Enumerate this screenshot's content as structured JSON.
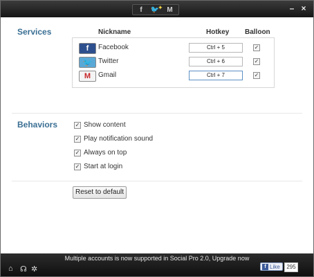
{
  "titlebar": {
    "icons": [
      "facebook-icon",
      "twitter-icon",
      "gmail-icon"
    ],
    "minimize_label": "–",
    "close_label": "×"
  },
  "services": {
    "title": "Services",
    "headers": {
      "nickname": "Nickname",
      "hotkey": "Hotkey",
      "balloon": "Balloon"
    },
    "items": [
      {
        "name": "Facebook",
        "icon": "facebook-icon",
        "icon_glyph": "f",
        "hotkey": "Ctrl + 5",
        "balloon": true
      },
      {
        "name": "Twitter",
        "icon": "twitter-icon",
        "icon_glyph": "🐦",
        "hotkey": "Ctrl + 6",
        "balloon": true
      },
      {
        "name": "Gmail",
        "icon": "gmail-icon",
        "icon_glyph": "M",
        "hotkey": "Ctrl + 7",
        "balloon": true
      }
    ]
  },
  "behaviors": {
    "title": "Behaviors",
    "items": [
      {
        "label": "Show content",
        "checked": true
      },
      {
        "label": "Play notification sound",
        "checked": true
      },
      {
        "label": "Always on top",
        "checked": true
      },
      {
        "label": "Start at login",
        "checked": true
      }
    ]
  },
  "reset_button": "Reset to default",
  "footer": {
    "promo": "Multiple accounts is now supported in Social Pro 2.0, Upgrade now",
    "icons": [
      "home-icon",
      "headset-icon",
      "gear-icon"
    ],
    "like_label": "Like",
    "like_count": "295"
  },
  "checkmark": "✓"
}
